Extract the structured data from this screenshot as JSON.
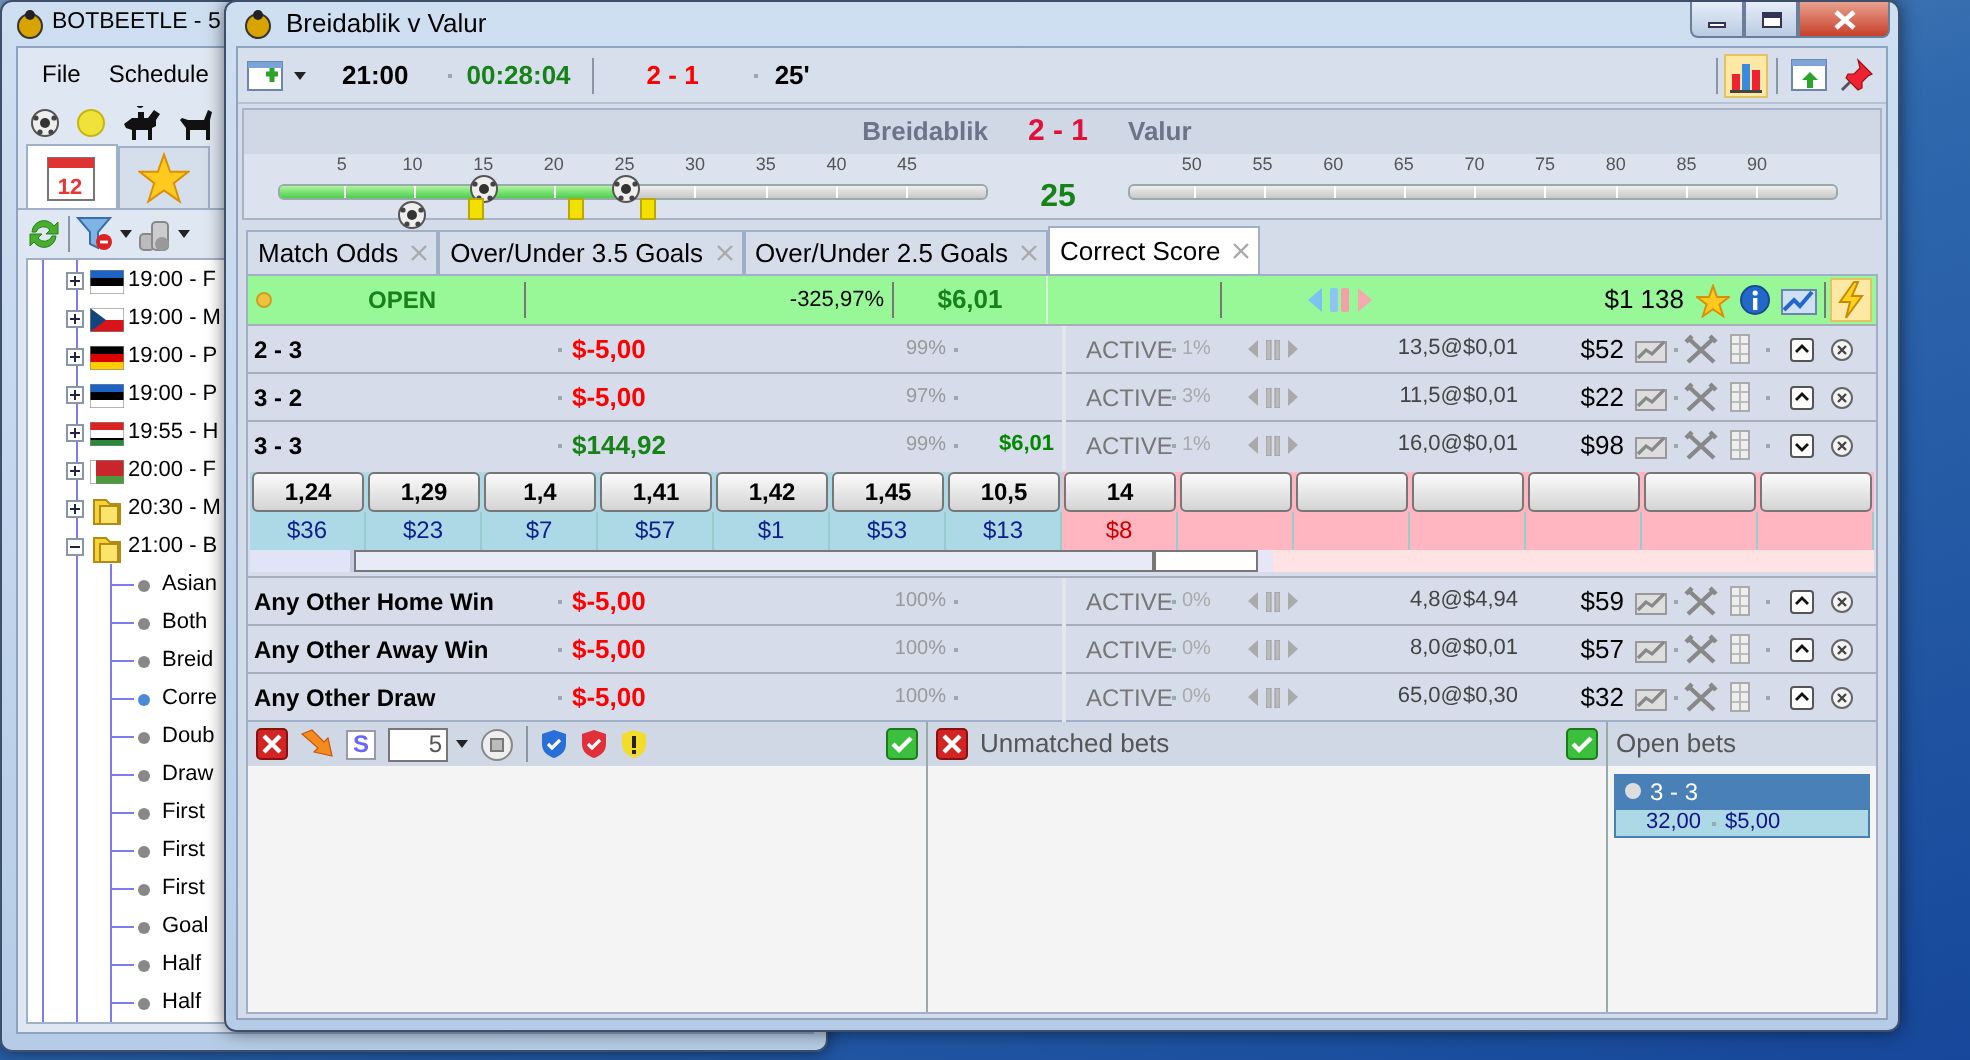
{
  "back_window": {
    "title": "BOTBEETLE - 5",
    "menu": [
      "File",
      "Schedule"
    ],
    "tabs": [
      {
        "kind": "calendar",
        "label": "12",
        "selected": true
      },
      {
        "kind": "star",
        "selected": false
      }
    ],
    "tree": [
      {
        "label": "19:00 - F",
        "kind": "estonia",
        "expanded": false
      },
      {
        "label": "19:00 - M",
        "kind": "czechia",
        "expanded": false
      },
      {
        "label": "19:00 - P",
        "kind": "germany",
        "expanded": false
      },
      {
        "label": "19:00 - P",
        "kind": "estonia",
        "expanded": false
      },
      {
        "label": "19:55 - H",
        "kind": "stripes",
        "expanded": false
      },
      {
        "label": "20:00 - F",
        "kind": "belarus",
        "expanded": false
      },
      {
        "label": "20:30 - M",
        "kind": "folder",
        "expanded": false
      },
      {
        "label": "21:00 - B",
        "kind": "folder",
        "expanded": true,
        "children": [
          {
            "label": "Asian",
            "selected": false
          },
          {
            "label": "Both",
            "selected": false
          },
          {
            "label": "Breid",
            "selected": false
          },
          {
            "label": "Corre",
            "selected": true
          },
          {
            "label": "Doub",
            "selected": false
          },
          {
            "label": "Draw",
            "selected": false
          },
          {
            "label": "First",
            "selected": false
          },
          {
            "label": "First",
            "selected": false
          },
          {
            "label": "First",
            "selected": false
          },
          {
            "label": "Goal",
            "selected": false
          },
          {
            "label": "Half",
            "selected": false
          },
          {
            "label": "Half",
            "selected": false
          }
        ]
      }
    ]
  },
  "window": {
    "title": "Breidablik v Valur"
  },
  "toolbar": {
    "start_time": "21:00",
    "clock": "00:28:04",
    "score": "2 - 1",
    "minute": "25'"
  },
  "timeline": {
    "home": "Breidablik",
    "score": "2 - 1",
    "away": "Valur",
    "minute": "25",
    "first_half": {
      "ticks": [
        "5",
        "10",
        "15",
        "20",
        "25",
        "30",
        "35",
        "40",
        "45"
      ],
      "level": 0.49
    },
    "second_half": {
      "ticks": [
        "50",
        "55",
        "60",
        "65",
        "70",
        "75",
        "80",
        "85",
        "90"
      ],
      "level": 0
    },
    "kind": "match"
  },
  "tabs": [
    {
      "label": "Match Odds",
      "selected": false
    },
    {
      "label": "Over/Under 3.5 Goals",
      "selected": false
    },
    {
      "label": "Over/Under 2.5 Goals",
      "selected": false
    },
    {
      "label": "Correct Score",
      "selected": true
    }
  ],
  "market": {
    "status": "OPEN",
    "percentage": "-325,97%",
    "profit": "$6,01",
    "matched": "$1 138"
  },
  "selections": [
    {
      "name": "2 - 3",
      "pnl": "$-5,00",
      "kind": "loss",
      "percent": "99%",
      "status": "ACTIVE",
      "share": "1%",
      "last": "13,5@$0,01",
      "volume": "$52",
      "expanded": false
    },
    {
      "name": "3 - 2",
      "pnl": "$-5,00",
      "kind": "loss",
      "percent": "97%",
      "status": "ACTIVE",
      "share": "3%",
      "last": "11,5@$0,01",
      "volume": "$22",
      "expanded": false
    },
    {
      "name": "3 - 3",
      "pnl": "$144,92",
      "kind": "profit",
      "percent": "99%",
      "profit": "$6,01",
      "status": "ACTIVE",
      "share": "1%",
      "last": "16,0@$0,01",
      "volume": "$98",
      "expanded": true,
      "ladder": [
        {
          "kind": "back",
          "price": "1,24",
          "amount": "$36"
        },
        {
          "kind": "back",
          "price": "1,29",
          "amount": "$23"
        },
        {
          "kind": "back",
          "price": "1,4",
          "amount": "$7"
        },
        {
          "kind": "back",
          "price": "1,41",
          "amount": "$57"
        },
        {
          "kind": "back",
          "price": "1,42",
          "amount": "$1"
        },
        {
          "kind": "back",
          "price": "1,45",
          "amount": "$53"
        },
        {
          "kind": "back",
          "price": "10,5",
          "amount": "$13"
        },
        {
          "kind": "lay",
          "price": "14",
          "amount": "$8"
        },
        {
          "kind": "lay"
        },
        {
          "kind": "lay"
        },
        {
          "kind": "lay"
        },
        {
          "kind": "lay"
        },
        {
          "kind": "lay"
        },
        {
          "kind": "lay"
        }
      ]
    },
    {
      "name": "Any Other Home Win",
      "pnl": "$-5,00",
      "kind": "loss",
      "percent": "100%",
      "status": "ACTIVE",
      "share": "0%",
      "last": "4,8@$4,94",
      "volume": "$59",
      "expanded": false
    },
    {
      "name": "Any Other Away Win",
      "pnl": "$-5,00",
      "kind": "loss",
      "percent": "100%",
      "status": "ACTIVE",
      "share": "0%",
      "last": "8,0@$0,01",
      "volume": "$57",
      "expanded": false
    },
    {
      "name": "Any Other Draw",
      "pnl": "$-5,00",
      "kind": "loss",
      "percent": "100%",
      "status": "ACTIVE",
      "share": "0%",
      "last": "65,0@$0,30",
      "volume": "$32",
      "expanded": false
    }
  ],
  "bet_panel": {
    "tool_label": "S",
    "stake": "5"
  },
  "unmatched": {
    "title": "Unmatched bets"
  },
  "open_bets": {
    "title": "Open bets",
    "bets": [
      {
        "selection": "3 - 3",
        "selected": true,
        "odds": "32,00",
        "stake": "$5,00"
      }
    ]
  }
}
